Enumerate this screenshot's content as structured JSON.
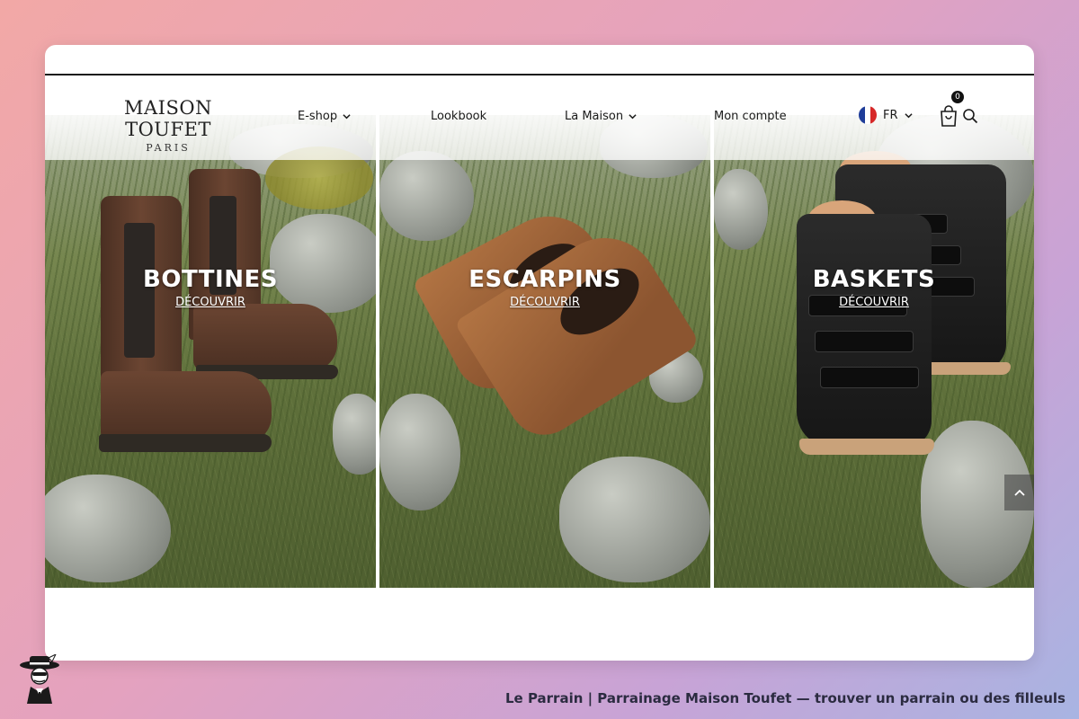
{
  "brand": {
    "name": "MAISON TOUFET",
    "city": "PARIS"
  },
  "nav": {
    "eshop": "E-shop",
    "lookbook": "Lookbook",
    "maison": "La Maison",
    "account": "Mon compte"
  },
  "lang": {
    "code": "FR",
    "flag_colors": [
      "#1f3d99",
      "#ffffff",
      "#d62828"
    ]
  },
  "cart": {
    "count": "0"
  },
  "panels": [
    {
      "title": "BOTTINES",
      "cta": "DÉCOUVRIR"
    },
    {
      "title": "ESCARPINS",
      "cta": "DÉCOUVRIR"
    },
    {
      "title": "BASKETS",
      "cta": "DÉCOUVRIR"
    }
  ],
  "footer": {
    "caption": "Le Parrain | Parrainage Maison Toufet — trouver un parrain ou des filleuls"
  },
  "icons": [
    "chevron-down-icon",
    "cart-icon",
    "search-icon",
    "chevron-up-icon",
    "mascot-icon"
  ],
  "colors": {
    "accent": "#111111",
    "text": "#1a1a1a"
  }
}
